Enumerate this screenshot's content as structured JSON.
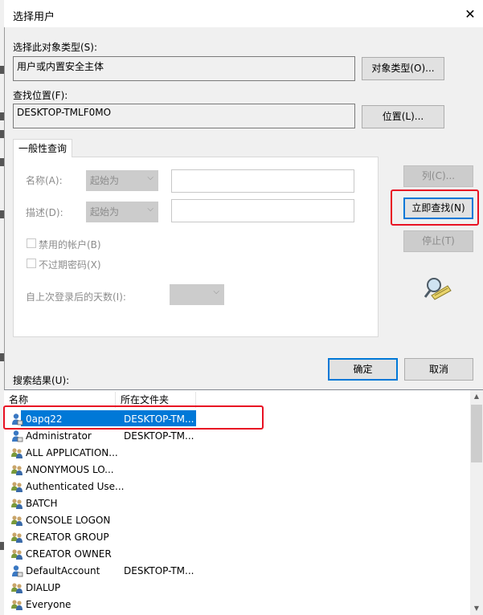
{
  "window": {
    "title": "选择用户",
    "close_glyph": "✕"
  },
  "object_type": {
    "label": "选择此对象类型(S):",
    "value": "用户或内置安全主体",
    "button": "对象类型(O)..."
  },
  "location": {
    "label": "查找位置(F):",
    "value": "DESKTOP-TMLF0MO",
    "button": "位置(L)..."
  },
  "general_query": {
    "tab_label": "一般性查询",
    "name_label": "名称(A):",
    "name_combo": "起始为",
    "desc_label": "描述(D):",
    "desc_combo": "起始为",
    "disabled_accounts": "禁用的帐户(B)",
    "non_expiring_pw": "不过期密码(X)",
    "days_since_logon": "自上次登录后的天数(I):"
  },
  "side_buttons": {
    "columns": "列(C)...",
    "find_now": "立即查找(N)",
    "stop": "停止(T)"
  },
  "dialog_buttons": {
    "ok": "确定",
    "cancel": "取消"
  },
  "results": {
    "label": "搜索结果(U):",
    "columns": [
      "名称",
      "所在文件夹"
    ],
    "rows": [
      {
        "name": "0apq22",
        "folder": "DESKTOP-TM...",
        "icon": "user-icon",
        "selected": true
      },
      {
        "name": "Administrator",
        "folder": "DESKTOP-TM...",
        "icon": "user-icon"
      },
      {
        "name": "ALL APPLICATION...",
        "folder": "",
        "icon": "group-icon"
      },
      {
        "name": "ANONYMOUS LO...",
        "folder": "",
        "icon": "group-icon"
      },
      {
        "name": "Authenticated Use...",
        "folder": "",
        "icon": "group-icon"
      },
      {
        "name": "BATCH",
        "folder": "",
        "icon": "group-icon"
      },
      {
        "name": "CONSOLE LOGON",
        "folder": "",
        "icon": "group-icon"
      },
      {
        "name": "CREATOR GROUP",
        "folder": "",
        "icon": "group-icon"
      },
      {
        "name": "CREATOR OWNER",
        "folder": "",
        "icon": "group-icon"
      },
      {
        "name": "DefaultAccount",
        "folder": "DESKTOP-TM...",
        "icon": "user-icon"
      },
      {
        "name": "DIALUP",
        "folder": "",
        "icon": "group-icon"
      },
      {
        "name": "Everyone",
        "folder": "",
        "icon": "group-icon"
      }
    ]
  },
  "colors": {
    "selection": "#0078d7",
    "highlight_box": "#e81123",
    "dialog_bg": "#f0f0f0"
  }
}
